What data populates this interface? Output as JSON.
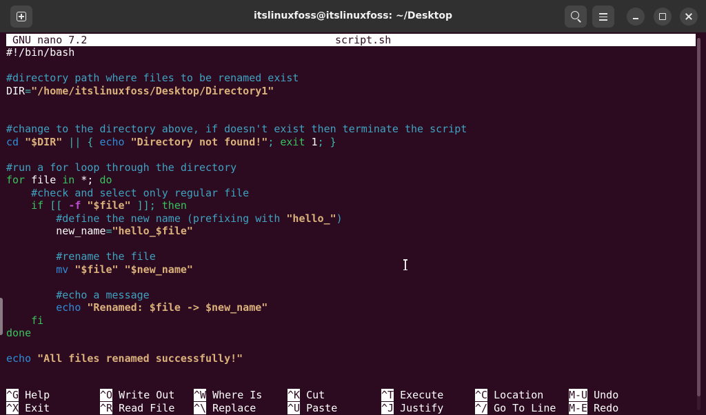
{
  "window": {
    "title": "itslinuxfoss@itslinuxfoss: ~/Desktop"
  },
  "icons": {
    "new_tab": "new-tab-icon",
    "search": "search-icon",
    "menu": "hamburger-menu-icon",
    "minimize": "minimize-icon",
    "maximize": "maximize-icon",
    "close": "close-icon"
  },
  "colors": {
    "background": "#2c0a1f",
    "titlebar": "#303030",
    "comment": "#3fa3c2",
    "string": "#dcb27c",
    "keyword": "#2f8dd8",
    "operator": "#41b5b0",
    "number": "#39c35e",
    "test_flag": "#ba4fd1"
  },
  "nano": {
    "version": "GNU nano 7.2",
    "filename": "script.sh"
  },
  "code": [
    [
      {
        "t": "#!/bin/bash",
        "c": "plain"
      }
    ],
    [],
    [
      {
        "t": "#directory path where files to be renamed exist",
        "c": "com"
      }
    ],
    [
      {
        "t": "DIR",
        "c": "plain"
      },
      {
        "t": "=",
        "c": "op"
      },
      {
        "t": "\"/home/itslinuxfoss/Desktop/Directory1\"",
        "c": "str"
      }
    ],
    [],
    [],
    [
      {
        "t": "#change to the directory above, if doesn't exist then terminate the script",
        "c": "com"
      }
    ],
    [
      {
        "t": "cd",
        "c": "kw"
      },
      {
        "t": " ",
        "c": "plain"
      },
      {
        "t": "\"$DIR\"",
        "c": "str"
      },
      {
        "t": " || { ",
        "c": "op"
      },
      {
        "t": "echo",
        "c": "kw"
      },
      {
        "t": " ",
        "c": "plain"
      },
      {
        "t": "\"Directory not found!\"",
        "c": "str"
      },
      {
        "t": "; ",
        "c": "op"
      },
      {
        "t": "exit",
        "c": "grn"
      },
      {
        "t": " 1",
        "c": "plain"
      },
      {
        "t": "; }",
        "c": "op"
      }
    ],
    [],
    [
      {
        "t": "#run a for loop through the directory",
        "c": "com"
      }
    ],
    [
      {
        "t": "for",
        "c": "grn"
      },
      {
        "t": " file ",
        "c": "plain"
      },
      {
        "t": "in",
        "c": "grn"
      },
      {
        "t": " *; ",
        "c": "plain"
      },
      {
        "t": "do",
        "c": "grn"
      }
    ],
    [
      {
        "t": "    #check and select only regular file",
        "c": "com"
      }
    ],
    [
      {
        "t": "    ",
        "c": "plain"
      },
      {
        "t": "if",
        "c": "grn"
      },
      {
        "t": " [[ ",
        "c": "op"
      },
      {
        "t": "-f",
        "c": "mag"
      },
      {
        "t": " ",
        "c": "plain"
      },
      {
        "t": "\"$file\"",
        "c": "str"
      },
      {
        "t": " ]]; ",
        "c": "op"
      },
      {
        "t": "then",
        "c": "grn"
      }
    ],
    [
      {
        "t": "        #define the new name (prefixing with ",
        "c": "com"
      },
      {
        "t": "\"hello_\"",
        "c": "str"
      },
      {
        "t": ")",
        "c": "com"
      }
    ],
    [
      {
        "t": "        new_name",
        "c": "plain"
      },
      {
        "t": "=",
        "c": "op"
      },
      {
        "t": "\"hello_$file\"",
        "c": "str"
      }
    ],
    [],
    [
      {
        "t": "        #rename the file",
        "c": "com"
      }
    ],
    [
      {
        "t": "        ",
        "c": "plain"
      },
      {
        "t": "mv",
        "c": "kw"
      },
      {
        "t": " ",
        "c": "plain"
      },
      {
        "t": "\"$file\"",
        "c": "str"
      },
      {
        "t": " ",
        "c": "plain"
      },
      {
        "t": "\"$new_name\"",
        "c": "str"
      }
    ],
    [],
    [
      {
        "t": "        #echo a message",
        "c": "com"
      }
    ],
    [
      {
        "t": "        ",
        "c": "plain"
      },
      {
        "t": "echo",
        "c": "kw"
      },
      {
        "t": " ",
        "c": "plain"
      },
      {
        "t": "\"Renamed: $file -> $new_name\"",
        "c": "str"
      }
    ],
    [
      {
        "t": "    fi",
        "c": "grn"
      }
    ],
    [
      {
        "t": "done",
        "c": "grn"
      }
    ],
    [],
    [
      {
        "t": "echo",
        "c": "kw"
      },
      {
        "t": " ",
        "c": "plain"
      },
      {
        "t": "\"All files renamed successfully!\"",
        "c": "str"
      }
    ]
  ],
  "shortcuts": [
    [
      {
        "key": "^G",
        "label": "Help"
      },
      {
        "key": "^X",
        "label": "Exit"
      }
    ],
    [
      {
        "key": "^O",
        "label": "Write Out"
      },
      {
        "key": "^R",
        "label": "Read File"
      }
    ],
    [
      {
        "key": "^W",
        "label": "Where Is"
      },
      {
        "key": "^\\",
        "label": "Replace"
      }
    ],
    [
      {
        "key": "^K",
        "label": "Cut"
      },
      {
        "key": "^U",
        "label": "Paste"
      }
    ],
    [
      {
        "key": "^T",
        "label": "Execute"
      },
      {
        "key": "^J",
        "label": "Justify"
      }
    ],
    [
      {
        "key": "^C",
        "label": "Location"
      },
      {
        "key": "^/",
        "label": "Go To Line"
      }
    ],
    [
      {
        "key": "M-U",
        "label": "Undo"
      },
      {
        "key": "M-E",
        "label": "Redo"
      }
    ]
  ]
}
